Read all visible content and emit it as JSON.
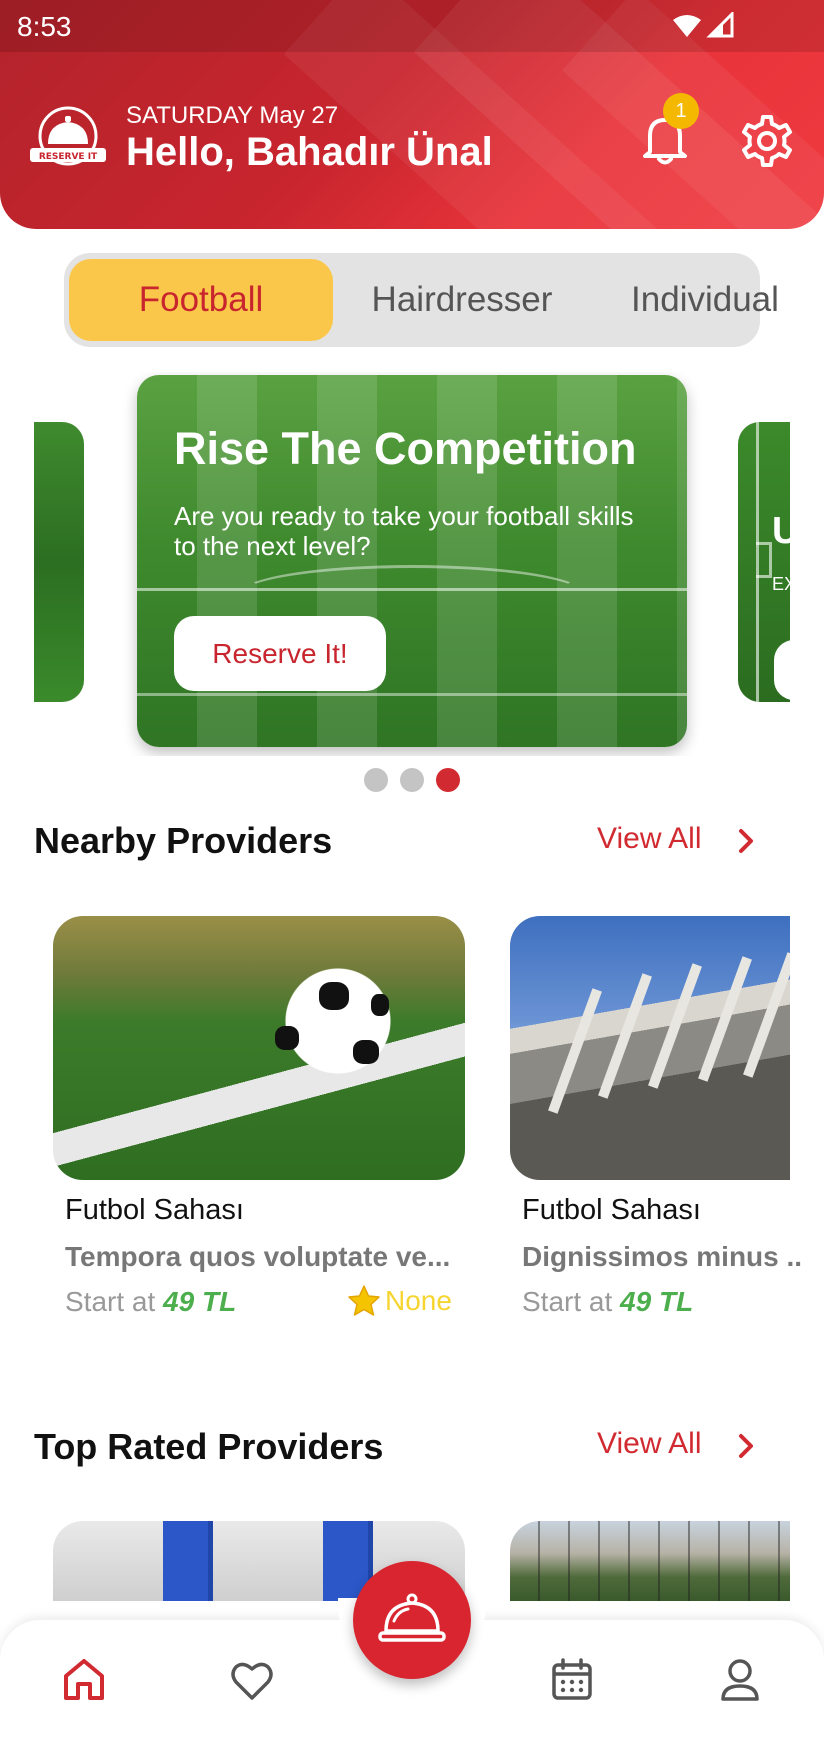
{
  "status_bar": {
    "time": "8:53"
  },
  "header": {
    "logo_text": "RESERVE IT",
    "date": "SATURDAY May 27",
    "greeting": "Hello, Bahadır Ünal",
    "notification_count": "1"
  },
  "category_tabs": {
    "selected": "Football",
    "items": [
      {
        "label": "Football"
      },
      {
        "label": "Hairdresser"
      },
      {
        "label": "Individual"
      }
    ]
  },
  "carousel": {
    "slide_count": 3,
    "active_index": 2,
    "active_slide": {
      "title": "Rise The Competition",
      "subtitle": "Are you ready to take your football skills to the next level?",
      "button_label": "Reserve It!"
    },
    "next_slide_partial": {
      "title_fragment": "U",
      "subtitle_fragment": "EX"
    }
  },
  "nearby_providers": {
    "title": "Nearby Providers",
    "view_all": "View All",
    "items": [
      {
        "name": "Futbol Sahası",
        "description": "Tempora quos voluptate ve...",
        "price_prefix": "Start at ",
        "price": "49 TL",
        "rating": "None"
      },
      {
        "name": "Futbol Sahası",
        "description": "Dignissimos minus ...",
        "price_prefix": "Start at ",
        "price": "49 TL"
      }
    ]
  },
  "top_rated_providers": {
    "title": "Top Rated Providers",
    "view_all": "View All"
  },
  "colors": {
    "brand_red": "#d12a31",
    "tab_active_bg": "#fbc74a",
    "price_green": "#4cae4c",
    "star_yellow": "#f7d531",
    "badge_yellow": "#f5b800"
  },
  "bottom_nav": {
    "items": [
      {
        "icon": "home-icon",
        "active": true
      },
      {
        "icon": "heart-icon",
        "active": false
      },
      {
        "icon": "reserve-bell-icon",
        "active": false
      },
      {
        "icon": "calendar-icon",
        "active": false
      },
      {
        "icon": "profile-icon",
        "active": false
      }
    ]
  }
}
